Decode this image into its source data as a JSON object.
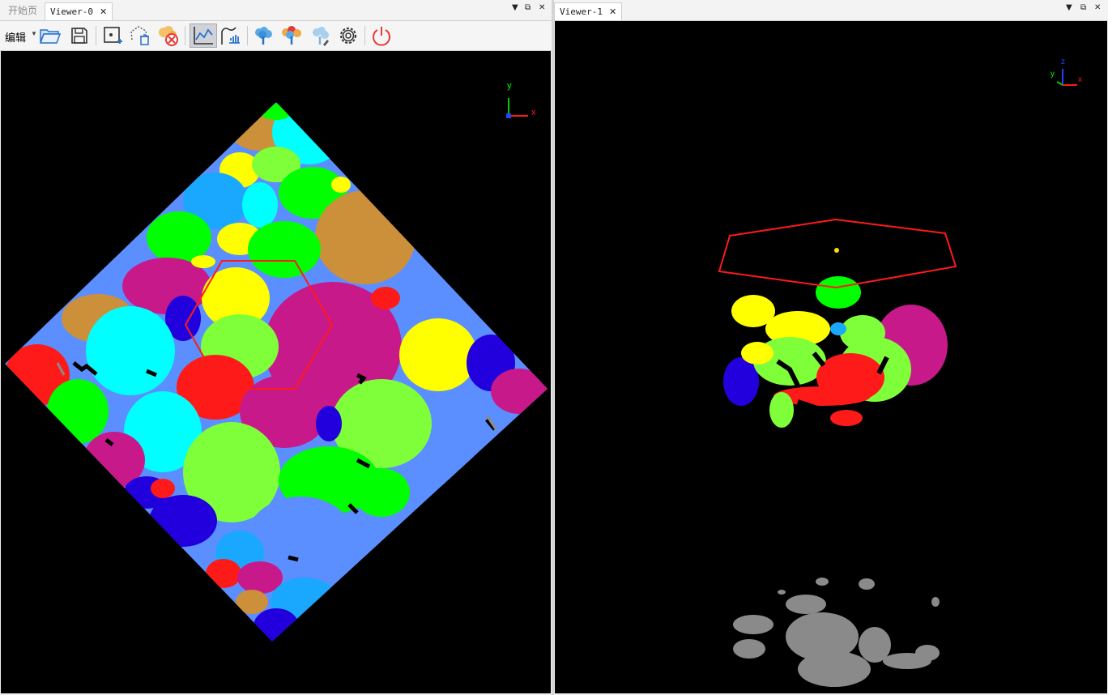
{
  "left_pane": {
    "tabs": [
      {
        "label": "开始页",
        "active": false
      },
      {
        "label": "Viewer-0",
        "active": true
      }
    ],
    "toolbar": {
      "edit_label": "编辑",
      "buttons": [
        {
          "icon": "folder-open-icon"
        },
        {
          "icon": "save-icon"
        },
        {
          "icon": "add-point-icon"
        },
        {
          "icon": "delete-region-icon"
        },
        {
          "icon": "clear-cloud-icon"
        },
        {
          "icon": "profile-line-icon",
          "pressed": true
        },
        {
          "icon": "hand-draw-icon"
        },
        {
          "icon": "tree-single-icon"
        },
        {
          "icon": "tree-multi-color-icon"
        },
        {
          "icon": "tree-edit-icon"
        },
        {
          "icon": "gear-icon"
        },
        {
          "icon": "power-icon"
        }
      ]
    },
    "axis": {
      "x": "x",
      "y": "y"
    }
  },
  "right_pane": {
    "tabs": [
      {
        "label": "Viewer-1",
        "active": true
      }
    ],
    "axis": {
      "x": "x",
      "y": "y",
      "z": "z"
    }
  },
  "colors": {
    "viewport_bg": "#000000",
    "selection": "#ff1a1a",
    "ground": "#8a8a8a",
    "segments": [
      "#ffff00",
      "#00ff00",
      "#7fff3a",
      "#ff1a1a",
      "#c8198a",
      "#00ffff",
      "#2200dd",
      "#5b8fff",
      "#1aa8ff",
      "#cc8f3a"
    ]
  }
}
